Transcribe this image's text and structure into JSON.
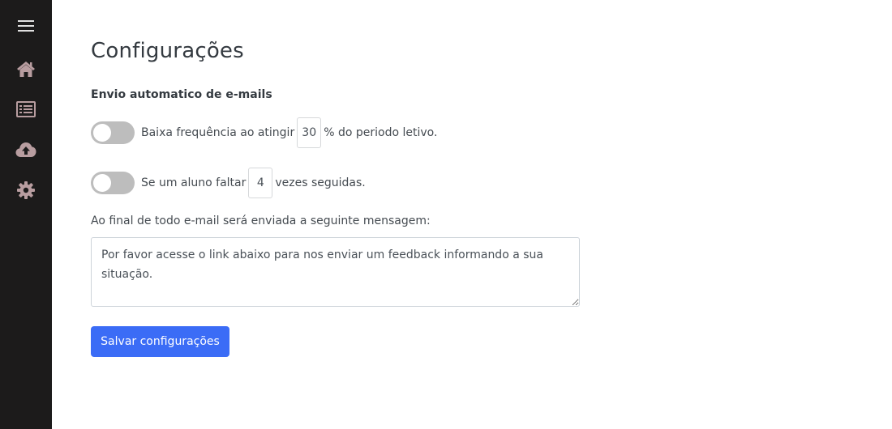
{
  "sidebar": {
    "items": [
      {
        "icon": "menu-icon"
      },
      {
        "icon": "home-icon"
      },
      {
        "icon": "list-icon"
      },
      {
        "icon": "cloud-upload-icon"
      },
      {
        "icon": "gear-icon"
      }
    ],
    "icon_color": "#b89da0",
    "menu_color": "#e0e0e0"
  },
  "page": {
    "title": "Configurações",
    "section_title": "Envio automatico de e-mails"
  },
  "rules": {
    "low_frequency": {
      "enabled": false,
      "text_before": "Baixa frequência ao atingir",
      "value": "30",
      "text_after": "% do periodo letivo."
    },
    "absences": {
      "enabled": false,
      "text_before": "Se um aluno faltar",
      "value": "4",
      "text_after": "vezes seguidas."
    }
  },
  "message": {
    "label": "Ao final de todo e-mail será enviada a seguinte mensagem:",
    "value": "Por favor acesse o link abaixo para nos enviar um feedback informando a sua situação."
  },
  "actions": {
    "save_label": "Salvar configurações"
  },
  "colors": {
    "sidebar_bg": "#1c1b1b",
    "primary": "#3b6cf6",
    "toggle_off": "#bdbdbd"
  }
}
